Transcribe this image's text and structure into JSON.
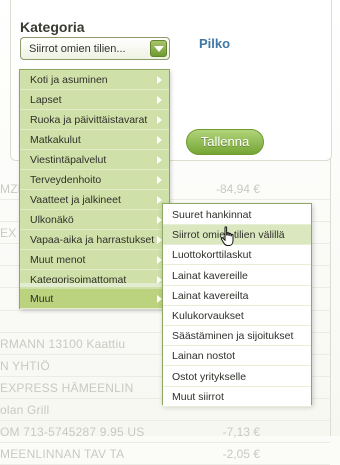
{
  "category": {
    "label": "Kategoria",
    "selected_value": "Siirrot omien tilien...",
    "pilko_link": "Pilko",
    "save_button": "Tallenna"
  },
  "background_rows": [
    {
      "text": "MZN",
      "amount": "-84,94 €"
    },
    {
      "text": "",
      "amount": ""
    },
    {
      "text": "EX",
      "amount": ""
    },
    {
      "text": "",
      "amount": ""
    },
    {
      "text": "",
      "amount": ""
    },
    {
      "text": "",
      "amount": ""
    },
    {
      "text": "",
      "amount": ""
    },
    {
      "text": "RMANN 13100 Kaattiu",
      "amount": ""
    },
    {
      "text": "N YHTIÖ",
      "amount": ""
    },
    {
      "text": "EXPRESS HÄMEENLIN",
      "amount": ""
    },
    {
      "text": "olan Grill",
      "amount": ""
    },
    {
      "text": "OM 713-5745287 9.95 US",
      "amount": "-7,13 €"
    },
    {
      "text": "MEENLINNAN TAV TA",
      "amount": "-2,05 €"
    }
  ],
  "dropdown": {
    "items": [
      {
        "label": "Koti ja asuminen"
      },
      {
        "label": "Lapset"
      },
      {
        "label": "Ruoka ja päivittäistavarat"
      },
      {
        "label": "Matkakulut"
      },
      {
        "label": "Viestintäpalvelut"
      },
      {
        "label": "Terveydenhoito"
      },
      {
        "label": "Vaatteet ja jalkineet"
      },
      {
        "label": "Ulkonäkö"
      },
      {
        "label": "Vapaa-aika ja harrastukset"
      },
      {
        "label": "Muut menot"
      },
      {
        "label": "Kategorisoimattomat"
      }
    ],
    "active_item": {
      "label": "Muut"
    }
  },
  "submenu": {
    "items": [
      {
        "label": "Suuret hankinnat"
      },
      {
        "label": "Siirrot omien tilien välillä"
      },
      {
        "label": "Luottokorttilaskut"
      },
      {
        "label": "Lainat kavereille"
      },
      {
        "label": "Lainat kavereilta"
      },
      {
        "label": "Kulukorvaukset"
      },
      {
        "label": "Säästäminen ja sijoitukset"
      },
      {
        "label": "Lainan nostot"
      },
      {
        "label": "Ostot yritykselle"
      },
      {
        "label": "Muut siirrot"
      }
    ],
    "hovered_index": 1
  },
  "icons": {
    "select_arrow": "chevron-down-icon",
    "submenu_arrow": "chevron-right-icon",
    "cursor": "hand-pointer-icon"
  },
  "colors": {
    "accent_green": "#75a535",
    "menu_bg": "#cfe0a9",
    "link_blue": "#3f78a6"
  }
}
